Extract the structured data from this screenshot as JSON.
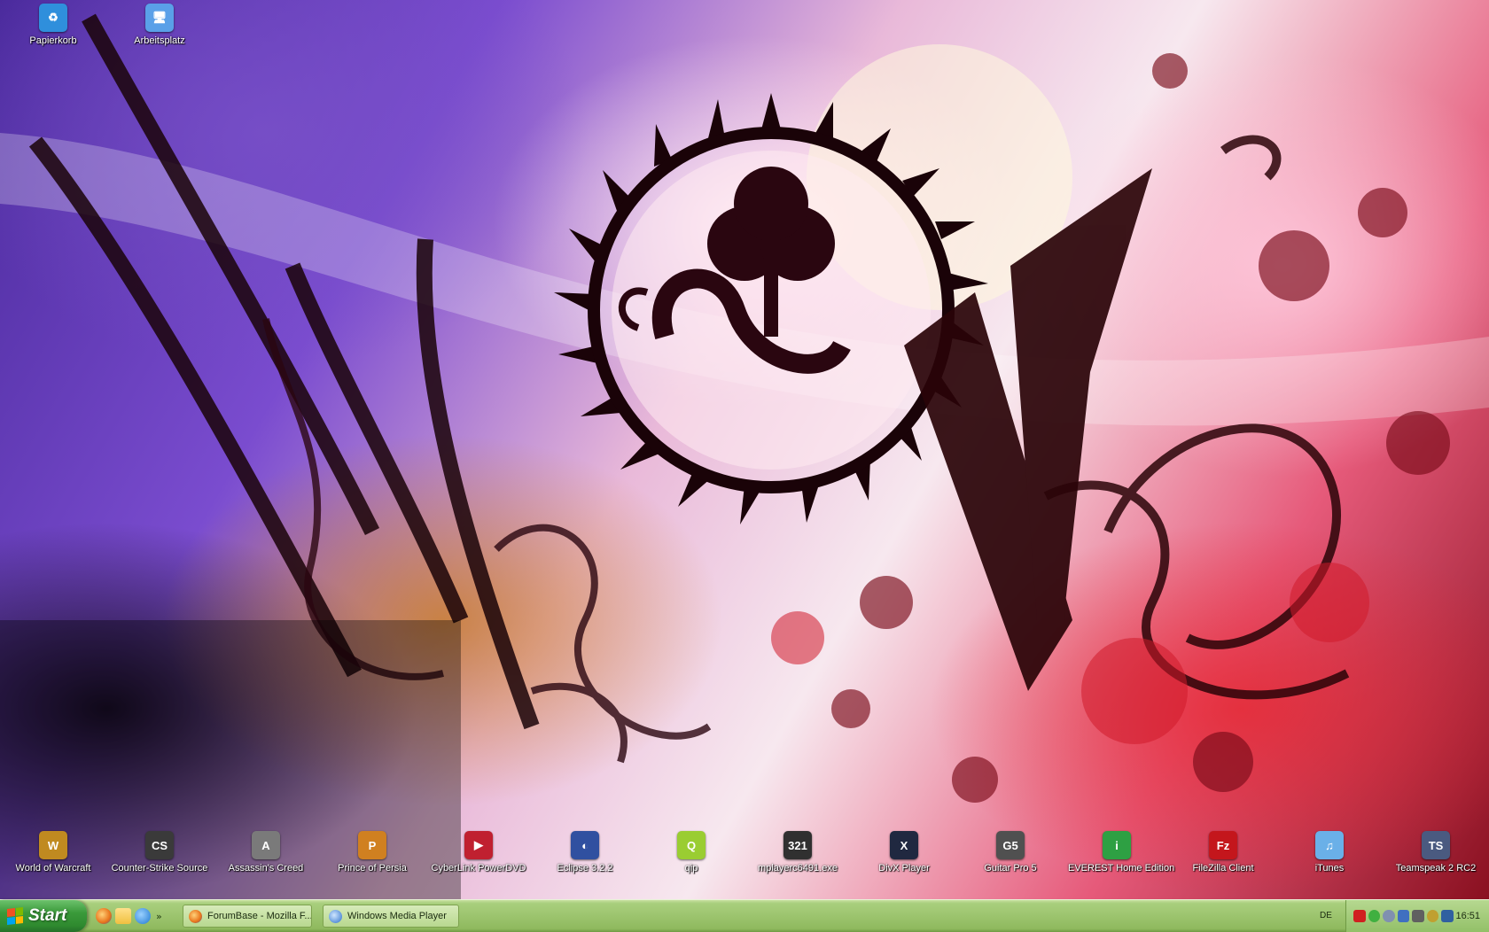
{
  "desktop": {
    "top_icons": [
      {
        "label": "Papierkorb",
        "icon": "recycle-bin-icon",
        "color": "#2f8fdc"
      },
      {
        "label": "Arbeitsplatz",
        "icon": "my-computer-icon",
        "color": "#5aa0e8"
      }
    ],
    "bottom_icons": [
      {
        "label": "World of Warcraft",
        "icon": "world-of-warcraft-icon",
        "color": "#c08a20",
        "glyph": "W"
      },
      {
        "label": "Counter-Strike Source",
        "icon": "counter-strike-icon",
        "color": "#3a3a3a",
        "glyph": "CS"
      },
      {
        "label": "Assassin's Creed",
        "icon": "assassins-creed-icon",
        "color": "#7a7a7a",
        "glyph": "A"
      },
      {
        "label": "Prince of Persia",
        "icon": "prince-of-persia-icon",
        "color": "#d08020",
        "glyph": "P"
      },
      {
        "label": "CyberLink PowerDVD",
        "icon": "powerdvd-icon",
        "color": "#c02030",
        "glyph": "▶"
      },
      {
        "label": "Eclipse 3.2.2",
        "icon": "eclipse-icon",
        "color": "#3050a0",
        "glyph": "◐"
      },
      {
        "label": "qip",
        "icon": "qip-icon",
        "color": "#9acd32",
        "glyph": "Q"
      },
      {
        "label": "mplayerc6491.exe",
        "icon": "media-player-classic-icon",
        "color": "#303030",
        "glyph": "321"
      },
      {
        "label": "DivX Player",
        "icon": "divx-player-icon",
        "color": "#202840",
        "glyph": "X"
      },
      {
        "label": "Guitar Pro 5",
        "icon": "guitar-pro-icon",
        "color": "#505050",
        "glyph": "G5"
      },
      {
        "label": "EVEREST Home Edition",
        "icon": "everest-info-icon",
        "color": "#2ea043",
        "glyph": "i"
      },
      {
        "label": "FileZilla Client",
        "icon": "filezilla-icon",
        "color": "#c4161c",
        "glyph": "Fz"
      },
      {
        "label": "iTunes",
        "icon": "itunes-icon",
        "color": "#6ab0e8",
        "glyph": "♫"
      },
      {
        "label": "Teamspeak 2 RC2",
        "icon": "teamspeak-icon",
        "color": "#4a5a80",
        "glyph": "TS"
      }
    ]
  },
  "taskbar": {
    "start_label": "Start",
    "quick_launch": [
      {
        "icon": "firefox-icon",
        "color": "#e8731a"
      },
      {
        "icon": "folder-icon",
        "color": "#f0c040"
      },
      {
        "icon": "internet-explorer-icon",
        "color": "#1e78d0"
      }
    ],
    "more_label": "»",
    "tasks": [
      {
        "label": "ForumBase - Mozilla F...",
        "icon": "firefox-icon",
        "color": "#e8731a"
      },
      {
        "label": "Windows Media Player",
        "icon": "windows-media-player-icon",
        "color": "#2a6fc9"
      }
    ],
    "language": "DE",
    "tray_icons": [
      {
        "icon": "antivirus-tray-icon",
        "color": "#d02020"
      },
      {
        "icon": "icq-tray-icon",
        "color": "#40b040"
      },
      {
        "icon": "user-tray-icon",
        "color": "#8090b0"
      },
      {
        "icon": "network-tray-icon",
        "color": "#4070c0"
      },
      {
        "icon": "volume-tray-icon",
        "color": "#606060"
      },
      {
        "icon": "security-tray-icon",
        "color": "#c0a030"
      },
      {
        "icon": "update-tray-icon",
        "color": "#3060a0"
      }
    ],
    "clock": "16:51"
  }
}
